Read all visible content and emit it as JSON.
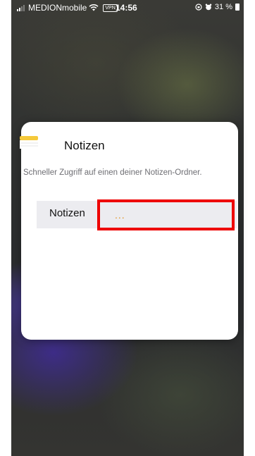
{
  "status_bar": {
    "carrier": "MEDIONmobile",
    "vpn": "VPN",
    "time": "14:56",
    "battery": "31 %"
  },
  "widget": {
    "title": "Notizen",
    "description": "Schneller Zugriff auf einen deiner Notizen-Ordner.",
    "folder_label": "Notizen",
    "folder_value": "..."
  },
  "colors": {
    "accent": "#e0901a",
    "highlight": "#ee0000"
  }
}
